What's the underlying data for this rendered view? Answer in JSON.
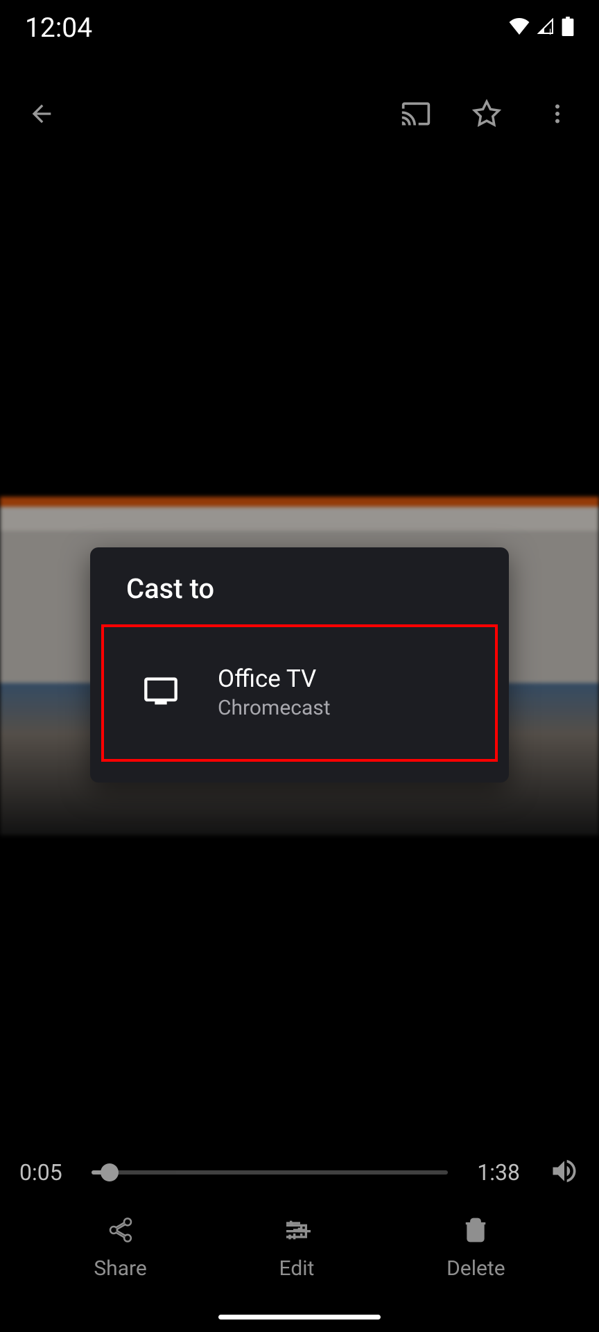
{
  "status": {
    "time": "12:04"
  },
  "dialog": {
    "title": "Cast to",
    "device": {
      "name": "Office TV",
      "type": "Chromecast"
    }
  },
  "player": {
    "elapsed": "0:05",
    "duration": "1:38"
  },
  "actions": {
    "share": "Share",
    "edit": "Edit",
    "delete": "Delete"
  }
}
